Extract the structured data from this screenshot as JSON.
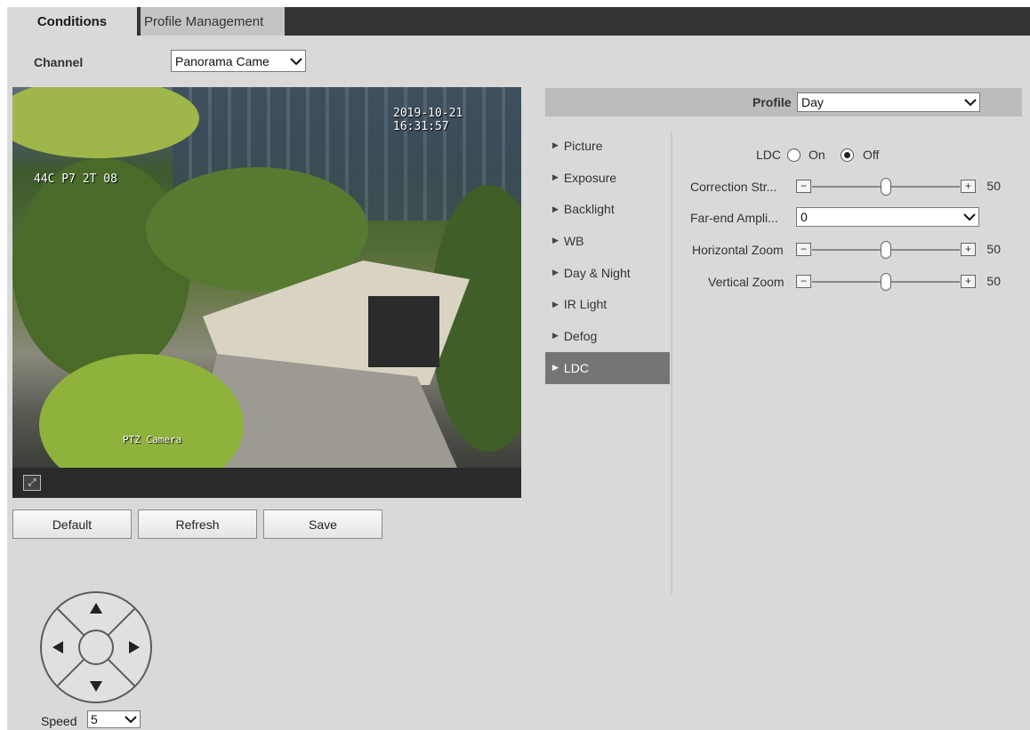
{
  "tabs": [
    {
      "label": "Conditions",
      "active": true
    },
    {
      "label": "Profile Management",
      "active": false
    }
  ],
  "channel": {
    "label": "Channel",
    "value": "Panorama Came"
  },
  "video": {
    "timestamp": "2019-10-21 16:31:57",
    "osd_top_left": "44C P7 2T 08",
    "osd_bottom": "PTZ Camera"
  },
  "buttons": {
    "default": "Default",
    "refresh": "Refresh",
    "save": "Save"
  },
  "ptz": {
    "speed_label": "Speed",
    "speed_value": "5"
  },
  "profile": {
    "label": "Profile",
    "value": "Day"
  },
  "menu": [
    {
      "label": "Picture",
      "active": false
    },
    {
      "label": "Exposure",
      "active": false
    },
    {
      "label": "Backlight",
      "active": false
    },
    {
      "label": "WB",
      "active": false
    },
    {
      "label": "Day & Night",
      "active": false
    },
    {
      "label": "IR Light",
      "active": false
    },
    {
      "label": "Defog",
      "active": false
    },
    {
      "label": "LDC",
      "active": true
    }
  ],
  "ldc": {
    "label": "LDC",
    "on_label": "On",
    "off_label": "Off",
    "selected": "Off",
    "correction_strength": {
      "label": "Correction Str...",
      "value": 50
    },
    "far_end": {
      "label": "Far-end Ampli...",
      "value": "0"
    },
    "horizontal_zoom": {
      "label": "Horizontal Zoom",
      "value": 50
    },
    "vertical_zoom": {
      "label": "Vertical Zoom",
      "value": 50
    }
  },
  "icons": {
    "fit": "fit-screen-icon",
    "dropdown": "chevron-down-icon",
    "ptz": [
      "arrow-up-icon",
      "arrow-down-icon",
      "arrow-left-icon",
      "arrow-right-icon"
    ]
  },
  "colors": {
    "active_menu": "#757575",
    "tabbar": "#333333",
    "panel": "#d9d9d9"
  }
}
